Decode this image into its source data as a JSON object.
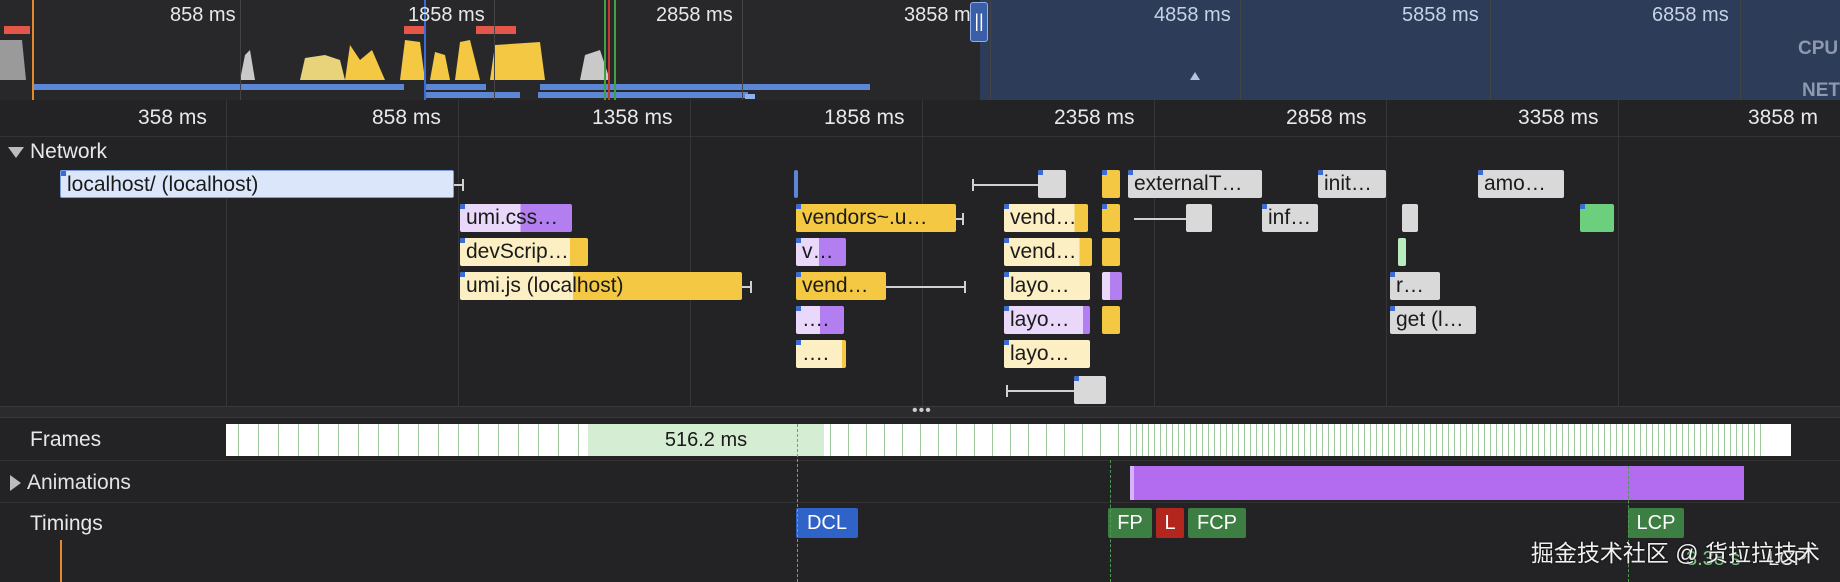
{
  "overview": {
    "ticks": [
      "858 ms",
      "1858 ms",
      "2858 ms",
      "3858 ms",
      "4858 ms",
      "5858 ms",
      "6858 ms"
    ],
    "cpu_label": "CPU",
    "net_label": "NET",
    "handle_glyph": "||"
  },
  "ruler": {
    "ticks": [
      "358 ms",
      "858 ms",
      "1358 ms",
      "1858 ms",
      "2358 ms",
      "2858 ms",
      "3358 ms",
      "3858 m"
    ]
  },
  "network": {
    "title": "Network",
    "requests": {
      "localhost": "localhost/ (localhost)",
      "umi_css": "umi.css…",
      "devscrip": "devScrip…",
      "umi_js": "umi.js (localhost)",
      "vendors_u": "vendors~.u…",
      "v": "v…",
      "vend_a": "vend…",
      "dots_a": "….",
      "dots_b": "….",
      "vend_b": "vend…",
      "vend_c": "vend…",
      "layo_a": "layo…",
      "layo_b": "layo…",
      "layo_c": "layo…",
      "externalT": "externalT…",
      "init": "init…",
      "amo": "amo…",
      "inf": "inf…",
      "r": "r…",
      "get": "get (l…"
    }
  },
  "tracks": {
    "frames": "Frames",
    "frames_long": "516.2 ms",
    "animations": "Animations",
    "timings": "Timings"
  },
  "timings": {
    "dcl": "DCL",
    "fp": "FP",
    "l": "L",
    "fcp": "FCP",
    "lcp": "LCP",
    "lcp_time": "3.38 s",
    "lcp_time_label": "LCP"
  },
  "watermark": "掘金技术社区 @ 货拉拉技术",
  "colors": {
    "document": "#dce6fb",
    "stylesheet": "#b27ef0",
    "script": "#f4c842",
    "fetch": "#d9d9d9",
    "image": "#6ccf7d",
    "dcl": "#2f63c8",
    "fp": "#3d7e43",
    "l": "#b3261e",
    "fcp": "#3d7e43",
    "animation": "#b36bf0"
  }
}
